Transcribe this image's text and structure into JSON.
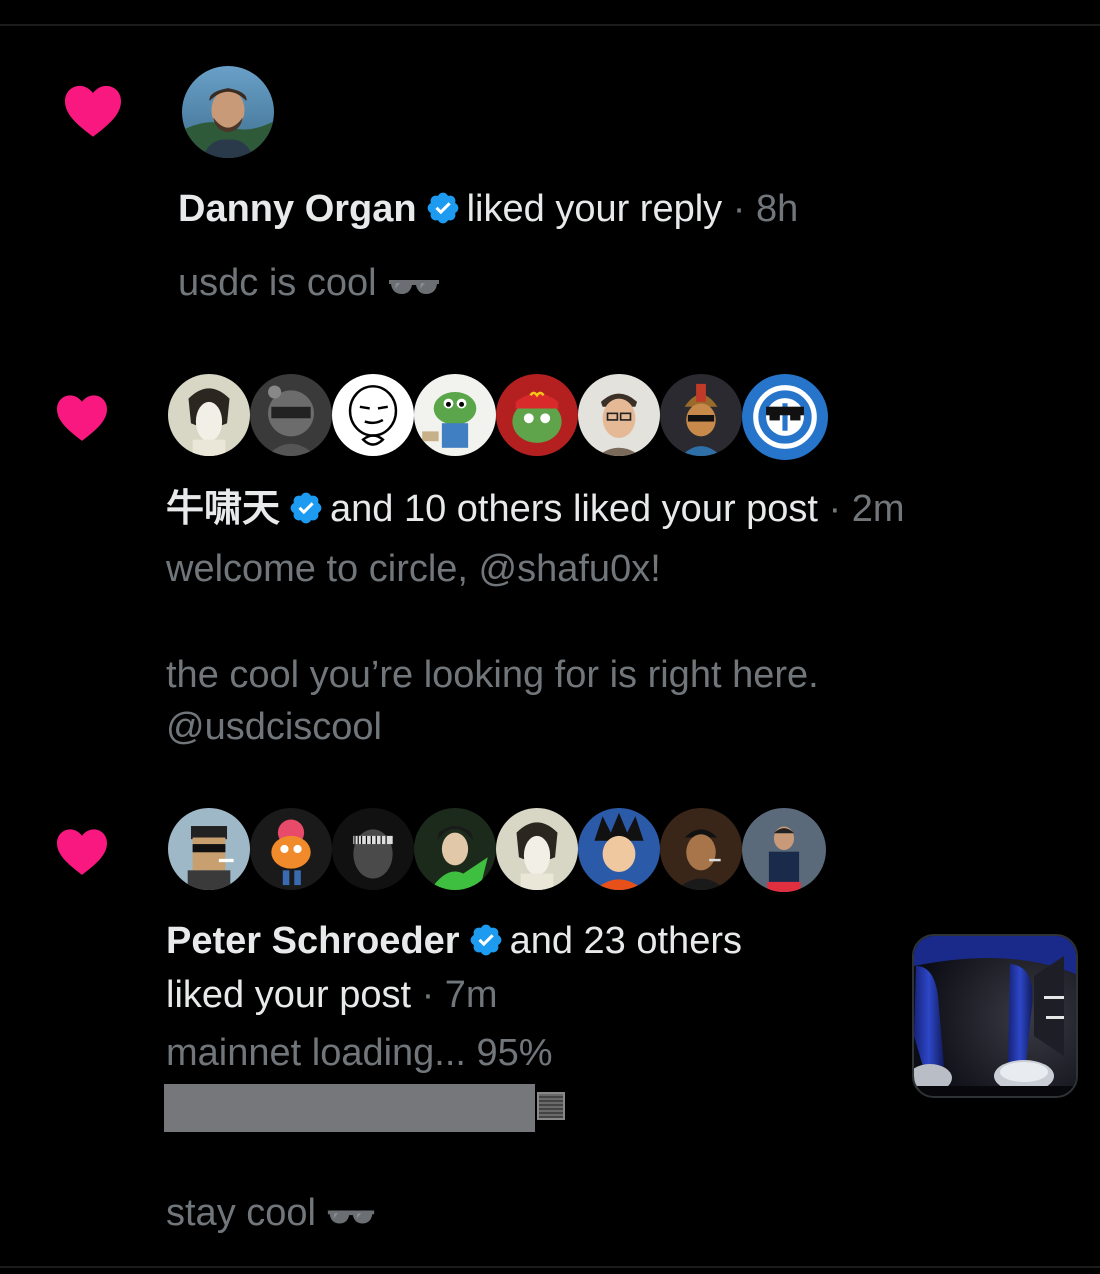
{
  "colors": {
    "heart": "#f91880",
    "verified": "#1d9bf0",
    "text": "#e7e9ea",
    "muted": "#71767b",
    "background": "#000000"
  },
  "notifications": [
    {
      "icon": "heart-icon",
      "user": "Danny Organ",
      "action": "liked your reply",
      "sep": " · ",
      "time": "8h",
      "post_text": "usdc is cool",
      "post_emoji": "sunglasses-icon"
    },
    {
      "icon": "heart-icon",
      "user": "牛啸天",
      "action": "and 10 others liked your post",
      "sep": " · ",
      "time": "2m",
      "post_lines": [
        "welcome to circle, @shafu0x!",
        "the cool you’re looking for is right here.",
        "@usdciscool"
      ]
    },
    {
      "icon": "heart-icon",
      "user": "Peter Schroeder",
      "action_line1": "and 23 others",
      "action_line2": "liked your post",
      "sep": " · ",
      "time": "7m",
      "post_lines": [
        "mainnet loading... 95%",
        "stay cool"
      ],
      "progress_percent": 95,
      "post_emoji": "sunglasses-icon",
      "thumbnail": "post-thumbnail-image"
    }
  ]
}
